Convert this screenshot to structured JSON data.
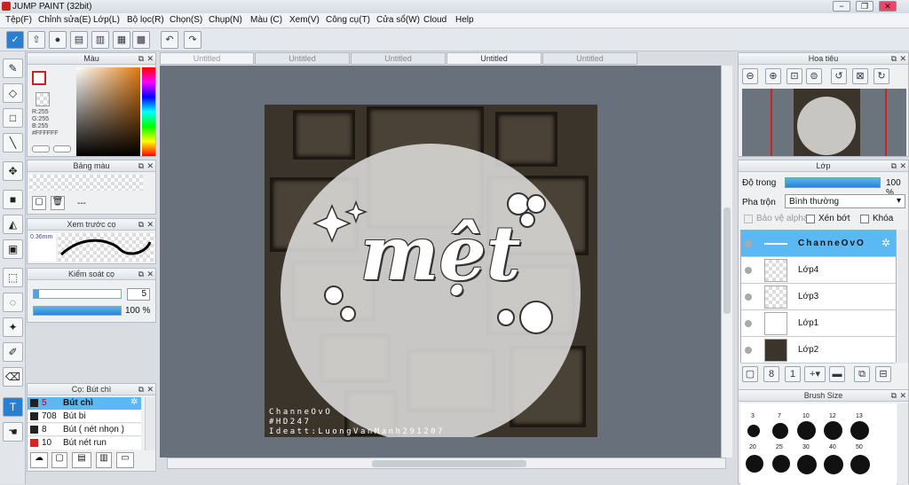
{
  "window": {
    "title": "JUMP PAINT (32bit)",
    "controls": {
      "minimize": "−",
      "restore": "❐",
      "close": "✕"
    }
  },
  "menu": [
    "Tệp(F)",
    "Chỉnh sửa(E)",
    "Lớp(L)",
    "Bộ lọc(R)",
    "Chọn(S)",
    "Chụp(N)",
    "Màu (C)",
    "Xem(V)",
    "Công cụ(T)",
    "Cửa sổ(W)",
    "Cloud",
    "Help"
  ],
  "tabs": [
    "Untitled",
    "Untitled",
    "Untitled",
    "Untitled",
    "Untitled"
  ],
  "color_panel": {
    "title": "Màu",
    "r": "R:255",
    "g": "G:255",
    "b": "B:255",
    "hex": "#FFFFFF"
  },
  "palette_panel": {
    "title": "Bảng màu",
    "empty": "---"
  },
  "brush_preview": {
    "title": "Xem trước cọ",
    "size": "0.36mm"
  },
  "brush_control": {
    "title": "Kiểm soát cọ",
    "size_value": "5",
    "opacity_value": "100 %"
  },
  "brush_list": {
    "title": "Cọ: Bút chì",
    "items": [
      {
        "size": "5",
        "name": "Bút chì",
        "selected": true
      },
      {
        "size": "708",
        "name": "Bút bi"
      },
      {
        "size": "8",
        "name": "Bút ( nét nhọn )"
      },
      {
        "size": "10",
        "name": "Bút nét run"
      }
    ]
  },
  "navigator": {
    "title": "Hoa tiêu"
  },
  "layers_panel": {
    "title": "Lớp",
    "opacity_label": "Độ trong",
    "opacity_value": "100 %",
    "blend_label": "Pha trộn",
    "blend_value": "Bình thường",
    "protect_alpha": "Bảo vệ alpha",
    "clipping": "Xén bớt",
    "lock": "Khóa",
    "layers": [
      "ChanneOvO",
      "Lớp4",
      "Lớp3",
      "Lớp1",
      "Lớp2"
    ]
  },
  "brush_size": {
    "title": "Brush Size",
    "labels": [
      "3",
      "7",
      "10",
      "12",
      "13",
      "20",
      "25",
      "30",
      "40",
      "50"
    ]
  },
  "artwork": {
    "main_text": "mệt",
    "credit1": "ChanneOvO",
    "credit2": "#HD247",
    "credit3": "Ideatt:LuongVanManh291207"
  }
}
